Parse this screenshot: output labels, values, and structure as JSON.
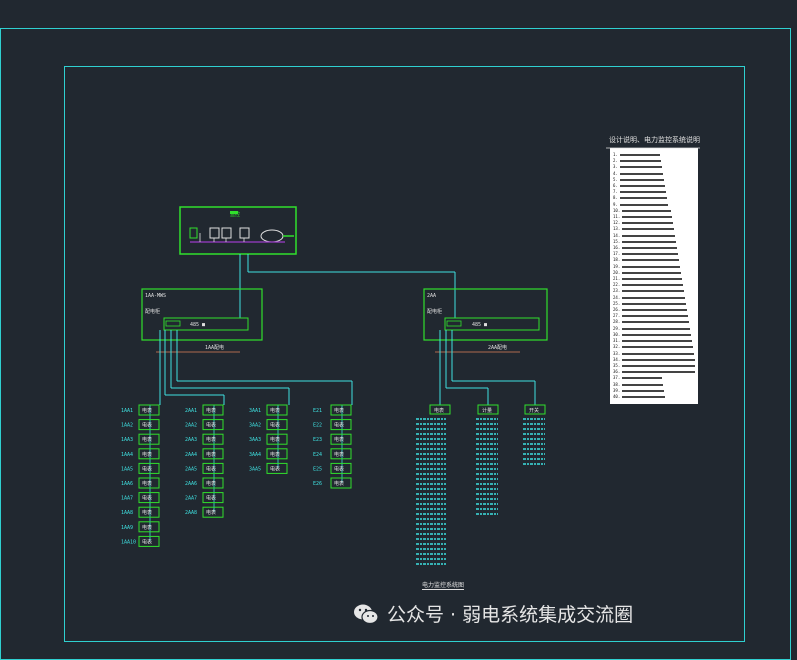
{
  "watermark": {
    "text": "公众号 · 弱电系统集成交流圈"
  },
  "notes": {
    "title": "设计说明、电力监控系统说明",
    "lines": [
      "1.",
      "2.",
      "3.",
      "4.",
      "5.",
      "6.",
      "7.",
      "8.",
      "9.",
      "10.",
      "11.",
      "12.",
      "13.",
      "14.",
      "15.",
      "16.",
      "17.",
      "18.",
      "19.",
      "20.",
      "21.",
      "22.",
      "23.",
      "24.",
      "25.",
      "26.",
      "27.",
      "28.",
      "29.",
      "30.",
      "31.",
      "32.",
      "33.",
      "34.",
      "35.",
      "36.",
      "37.",
      "38.",
      "39.",
      "40."
    ]
  },
  "top_box": {
    "title": "监控"
  },
  "left_box": {
    "title": "1AA-MWS",
    "sub": "配电柜",
    "bar": "485 ■"
  },
  "right_box": {
    "title": "2AA",
    "sub": "配电柜",
    "bar": "485 ■"
  },
  "left_caption": "1AA配电",
  "right_caption": "2AA配电",
  "bottom_caption": "电力监控系统图",
  "column_headers": [
    "1AA",
    "2AA",
    "3AA",
    "E2"
  ],
  "right_headers": [
    "电表",
    "计量",
    "开关"
  ],
  "device_label": "电表"
}
